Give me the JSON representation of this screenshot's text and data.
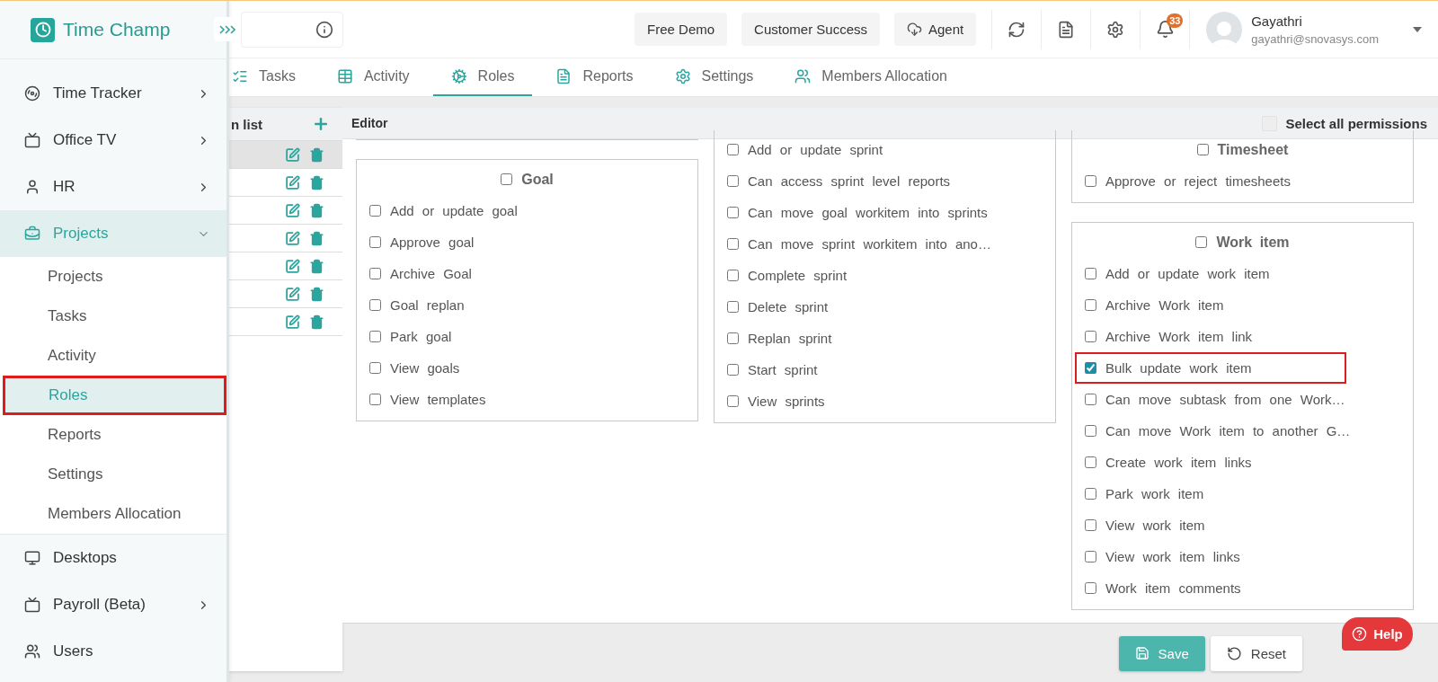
{
  "brand": {
    "name": "Time Champ"
  },
  "sidebar": {
    "items": [
      {
        "label": "Time Tracker",
        "has_submenu": true,
        "expanded": false,
        "selected": false
      },
      {
        "label": "Office TV",
        "has_submenu": true,
        "expanded": false,
        "selected": false
      },
      {
        "label": "HR",
        "has_submenu": true,
        "expanded": false,
        "selected": false
      },
      {
        "label": "Projects",
        "has_submenu": true,
        "expanded": true,
        "selected": true,
        "children": [
          {
            "label": "Projects",
            "selected": false,
            "highlighted": false
          },
          {
            "label": "Tasks",
            "selected": false,
            "highlighted": false
          },
          {
            "label": "Activity",
            "selected": false,
            "highlighted": false
          },
          {
            "label": "Roles",
            "selected": true,
            "highlighted": true
          },
          {
            "label": "Reports",
            "selected": false,
            "highlighted": false
          },
          {
            "label": "Settings",
            "selected": false,
            "highlighted": false
          },
          {
            "label": "Members Allocation",
            "selected": false,
            "highlighted": false
          }
        ]
      },
      {
        "label": "Desktops",
        "selected": false
      },
      {
        "label": "Payroll (Beta)",
        "has_submenu": true,
        "expanded": false,
        "selected": false
      },
      {
        "label": "Users",
        "selected": false
      }
    ]
  },
  "header": {
    "buttons": [
      {
        "label": "Free Demo"
      },
      {
        "label": "Customer Success"
      },
      {
        "label": "Agent"
      }
    ],
    "notification_count": "33",
    "user": {
      "name": "Gayathri",
      "email": "gayathri@snovasys.com"
    }
  },
  "tabs": [
    {
      "label": "Tasks",
      "selected": false
    },
    {
      "label": "Activity",
      "selected": false
    },
    {
      "label": "Roles",
      "selected": true
    },
    {
      "label": "Reports",
      "selected": false
    },
    {
      "label": "Settings",
      "selected": false
    },
    {
      "label": "Members Allocation",
      "selected": false
    }
  ],
  "role_list": {
    "title": "n list",
    "rows": [
      {
        "selected": true
      },
      {
        "selected": false
      },
      {
        "selected": false
      },
      {
        "selected": false
      },
      {
        "selected": false
      },
      {
        "selected": false
      },
      {
        "selected": false
      }
    ]
  },
  "editor": {
    "title": "Editor",
    "select_all": {
      "label": "Select all permissions",
      "checked": false
    },
    "columns": [
      {
        "groups": [
          {
            "clipped_top": true
          },
          {
            "clipped_top": false,
            "title": {
              "label": "Goal",
              "checked": false
            },
            "items": [
              {
                "label": "Add or update goal",
                "checked": false,
                "highlighted": false
              },
              {
                "label": "Approve goal",
                "checked": false,
                "highlighted": false
              },
              {
                "label": "Archive Goal",
                "checked": false,
                "highlighted": false
              },
              {
                "label": "Goal replan",
                "checked": false,
                "highlighted": false
              },
              {
                "label": "Park goal",
                "checked": false,
                "highlighted": false
              },
              {
                "label": "View goals",
                "checked": false,
                "highlighted": false
              },
              {
                "label": "View templates",
                "checked": false,
                "highlighted": false
              }
            ]
          }
        ]
      },
      {
        "groups": [
          {
            "clipped_top": true,
            "items": [
              {
                "label": "Add or update sprint",
                "checked": false,
                "highlighted": false
              },
              {
                "label": "Can access sprint level reports",
                "checked": false,
                "highlighted": false
              },
              {
                "label": "Can move goal workitem into sprints",
                "checked": false,
                "highlighted": false
              },
              {
                "label": "Can move sprint workitem into ano…",
                "checked": false,
                "highlighted": false
              },
              {
                "label": "Complete sprint",
                "checked": false,
                "highlighted": false
              },
              {
                "label": "Delete sprint",
                "checked": false,
                "highlighted": false
              },
              {
                "label": "Replan sprint",
                "checked": false,
                "highlighted": false
              },
              {
                "label": "Start sprint",
                "checked": false,
                "highlighted": false
              },
              {
                "label": "View sprints",
                "checked": false,
                "highlighted": false
              }
            ]
          }
        ]
      },
      {
        "groups": [
          {
            "clipped_top": true,
            "title": {
              "label": "Timesheet",
              "checked": false
            },
            "items": [
              {
                "label": "Approve or reject timesheets",
                "checked": false,
                "highlighted": false
              }
            ]
          },
          {
            "clipped_top": false,
            "title": {
              "label": "Work item",
              "checked": false
            },
            "items": [
              {
                "label": "Add or update work item",
                "checked": false,
                "highlighted": false
              },
              {
                "label": "Archive Work item",
                "checked": false,
                "highlighted": false
              },
              {
                "label": "Archive Work item link",
                "checked": false,
                "highlighted": false
              },
              {
                "label": "Bulk update work item",
                "checked": true,
                "highlighted": true
              },
              {
                "label": "Can move subtask from one Work…",
                "checked": false,
                "highlighted": false
              },
              {
                "label": "Can move Work item to another G…",
                "checked": false,
                "highlighted": false
              },
              {
                "label": "Create work item links",
                "checked": false,
                "highlighted": false
              },
              {
                "label": "Park work item",
                "checked": false,
                "highlighted": false
              },
              {
                "label": "View work item",
                "checked": false,
                "highlighted": false
              },
              {
                "label": "View work item links",
                "checked": false,
                "highlighted": false
              },
              {
                "label": "Work item comments",
                "checked": false,
                "highlighted": false
              }
            ]
          }
        ]
      }
    ]
  },
  "footer": {
    "buttons": [
      {
        "label": "Save",
        "kind": "primary"
      },
      {
        "label": "Reset",
        "kind": "secondary"
      }
    ]
  },
  "help": {
    "label": "Help"
  }
}
